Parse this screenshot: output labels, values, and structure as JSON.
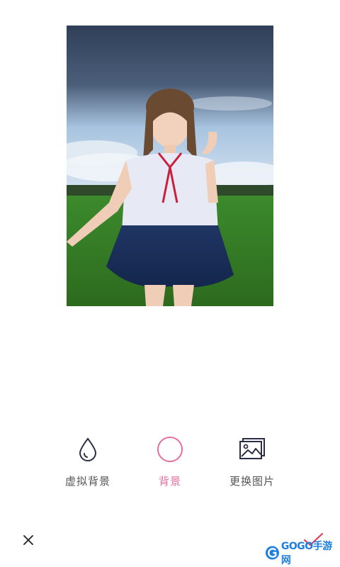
{
  "toolbar": {
    "items": [
      {
        "label": "虚拟背景",
        "icon": "droplet-icon",
        "active": false
      },
      {
        "label": "背景",
        "icon": "circle-icon",
        "active": true
      },
      {
        "label": "更换图片",
        "icon": "image-gallery-icon",
        "active": false
      }
    ]
  },
  "footer": {
    "close_icon": "close-icon",
    "confirm_icon": "checkmark-icon"
  },
  "watermark": {
    "text": "GOGO手游网"
  },
  "colors": {
    "accent": "#e46fa0",
    "icon_dark": "#2b2d45",
    "label_gray": "#555555",
    "watermark_blue": "#1d7fe0"
  }
}
